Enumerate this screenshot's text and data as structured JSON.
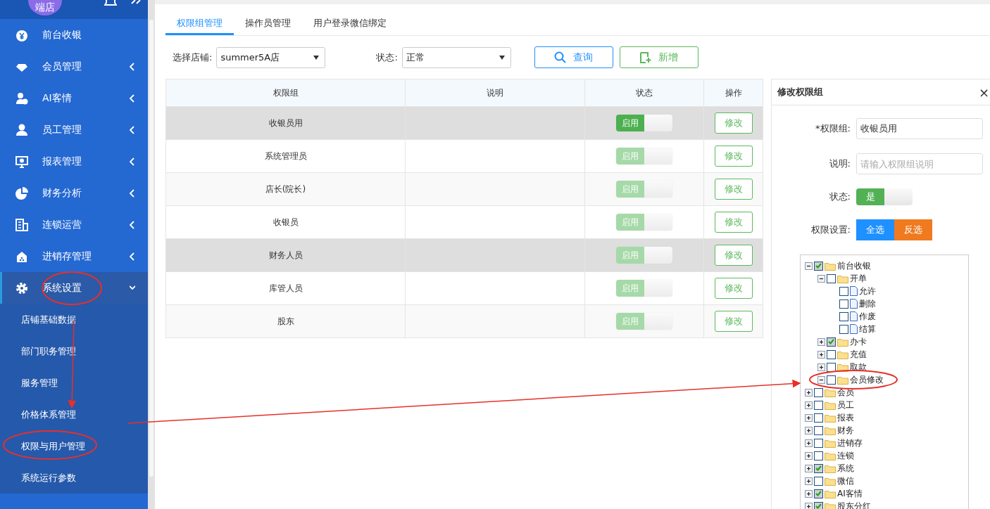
{
  "sidebar": {
    "avatar_text": "端店",
    "items": [
      {
        "label": "前台收银",
        "has_arrow": false,
        "expanded": false
      },
      {
        "label": "会员管理",
        "has_arrow": true,
        "expanded": false
      },
      {
        "label": "AI客情",
        "has_arrow": true,
        "expanded": false
      },
      {
        "label": "员工管理",
        "has_arrow": true,
        "expanded": false
      },
      {
        "label": "报表管理",
        "has_arrow": true,
        "expanded": false
      },
      {
        "label": "财务分析",
        "has_arrow": true,
        "expanded": false
      },
      {
        "label": "连锁运营",
        "has_arrow": true,
        "expanded": false
      },
      {
        "label": "进销存管理",
        "has_arrow": true,
        "expanded": false
      },
      {
        "label": "系统设置",
        "has_arrow": true,
        "expanded": true,
        "children": [
          {
            "label": "店铺基础数据"
          },
          {
            "label": "部门职务管理"
          },
          {
            "label": "服务管理"
          },
          {
            "label": "价格体系管理"
          },
          {
            "label": "权限与用户管理"
          },
          {
            "label": "系统运行参数"
          }
        ]
      }
    ]
  },
  "tabs": [
    {
      "label": "权限组管理",
      "selected": true
    },
    {
      "label": "操作员管理",
      "selected": false
    },
    {
      "label": "用户登录微信绑定",
      "selected": false
    }
  ],
  "filters": {
    "store_label": "选择店铺:",
    "store_value": "summer5A店",
    "status_label": "状态:",
    "status_value": "正常",
    "search_button": "查询",
    "add_button": "新增"
  },
  "table": {
    "columns": [
      "权限组",
      "说明",
      "状态",
      "操作"
    ],
    "rows": [
      {
        "group": "收银员用",
        "note": "",
        "status": "启用",
        "enabled": true,
        "highlighted": true,
        "action": "修改"
      },
      {
        "group": "系统管理员",
        "status": "启用",
        "enabled": false,
        "highlighted": false,
        "action": "修改"
      },
      {
        "group": "店长(院长)",
        "status": "启用",
        "enabled": false,
        "highlighted": false,
        "action": "修改"
      },
      {
        "group": "收银员",
        "status": "启用",
        "enabled": false,
        "highlighted": false,
        "action": "修改"
      },
      {
        "group": "财务人员",
        "status": "启用",
        "enabled": false,
        "highlighted": true,
        "action": "修改"
      },
      {
        "group": "库管人员",
        "status": "启用",
        "enabled": false,
        "highlighted": false,
        "action": "修改"
      },
      {
        "group": "股东",
        "status": "启用",
        "enabled": false,
        "highlighted": false,
        "action": "修改"
      }
    ]
  },
  "panel": {
    "title": "修改权限组",
    "close": "×",
    "group_label": "*权限组:",
    "group_value": "收银员用",
    "note_label": "说明:",
    "note_placeholder": "请输入权限组说明",
    "status_label": "状态:",
    "status_value": "是",
    "status_on": true,
    "perm_label": "权限设置:",
    "select_all": "全选",
    "invert": "反选",
    "tree": [
      {
        "label": "前台收银",
        "kind": "folder",
        "checked": true,
        "expanded": true,
        "children": [
          {
            "label": "开单",
            "kind": "folder",
            "checked": false,
            "expanded": true,
            "children": [
              {
                "label": "允许",
                "kind": "file",
                "checked": false
              },
              {
                "label": "删除",
                "kind": "file",
                "checked": false
              },
              {
                "label": "作废",
                "kind": "file",
                "checked": false
              },
              {
                "label": "结算",
                "kind": "file",
                "checked": false
              }
            ]
          },
          {
            "label": "办卡",
            "kind": "folder",
            "checked": true,
            "expanded": false
          },
          {
            "label": "充值",
            "kind": "folder",
            "checked": false,
            "expanded": false
          },
          {
            "label": "取款",
            "kind": "folder",
            "checked": false,
            "expanded": false
          },
          {
            "label": "会员修改",
            "kind": "folder",
            "checked": false,
            "expanded": true
          }
        ]
      },
      {
        "label": "会员",
        "kind": "folder",
        "checked": false,
        "expanded": false
      },
      {
        "label": "员工",
        "kind": "folder",
        "checked": false,
        "expanded": false
      },
      {
        "label": "报表",
        "kind": "folder",
        "checked": false,
        "expanded": false
      },
      {
        "label": "财务",
        "kind": "folder",
        "checked": false,
        "expanded": false
      },
      {
        "label": "进销存",
        "kind": "folder",
        "checked": false,
        "expanded": false
      },
      {
        "label": "连锁",
        "kind": "folder",
        "checked": false,
        "expanded": false
      },
      {
        "label": "系统",
        "kind": "folder",
        "checked": true,
        "expanded": false
      },
      {
        "label": "微信",
        "kind": "folder",
        "checked": false,
        "expanded": false
      },
      {
        "label": "AI客情",
        "kind": "folder",
        "checked": true,
        "expanded": false
      },
      {
        "label": "股东分红",
        "kind": "folder",
        "checked": true,
        "expanded": false
      }
    ]
  }
}
